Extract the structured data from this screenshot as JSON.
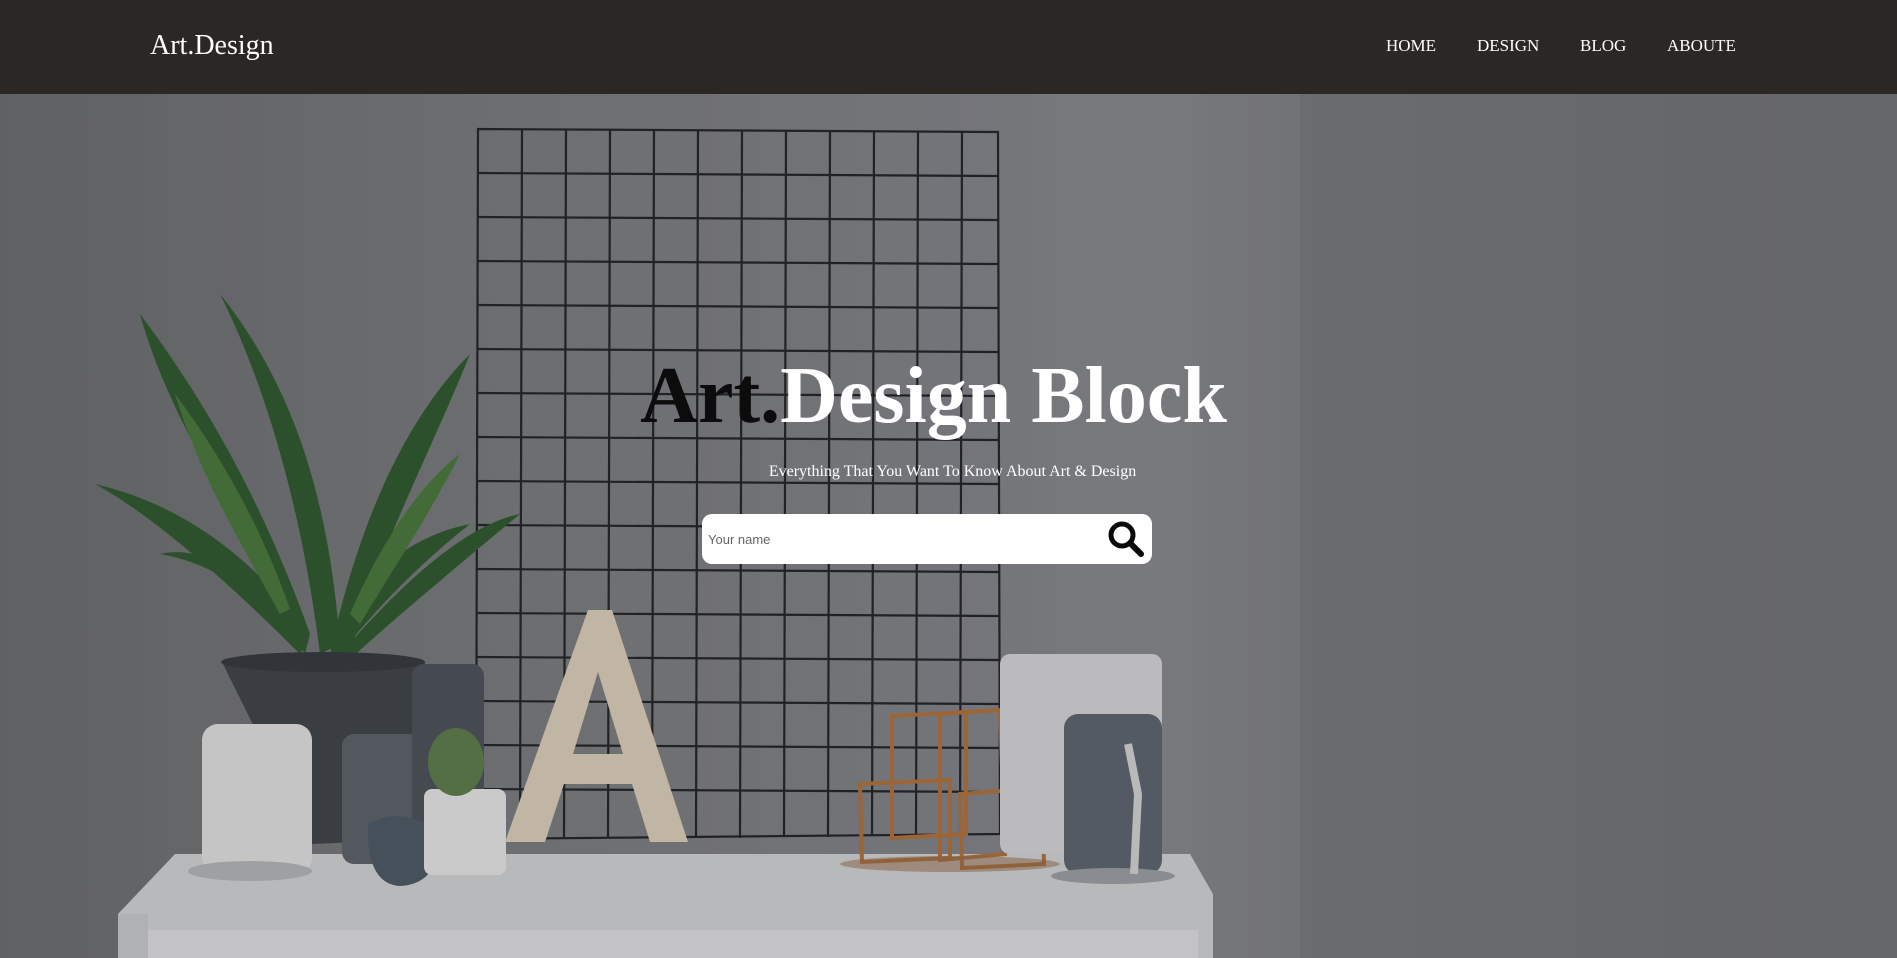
{
  "header": {
    "logo": "Art.Design",
    "nav": [
      "HOME",
      "DESIGN",
      "BLOG",
      "ABOUTE"
    ]
  },
  "hero": {
    "title_part1": "Art.",
    "title_part2": "Design Block",
    "subtitle": "Everything That You Want To Know About Art & Design"
  },
  "search": {
    "placeholder": "Your name",
    "icon": "search-icon"
  },
  "colors": {
    "header_bg": "#2b2725",
    "hero_overlay": "#7b7d7f",
    "text_light": "#ffffff"
  }
}
